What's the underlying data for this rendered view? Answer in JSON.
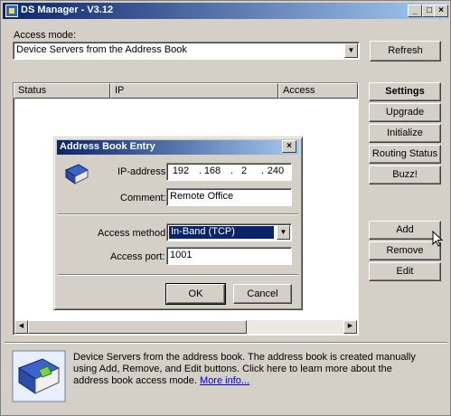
{
  "window": {
    "title": "DS Manager - V3.12"
  },
  "access_mode": {
    "label": "Access mode:",
    "selected": "Device Servers from the Address Book",
    "refresh_label": "Refresh"
  },
  "table": {
    "columns": [
      "Status",
      "IP",
      "Access"
    ]
  },
  "buttons": {
    "settings": "Settings",
    "upgrade": "Upgrade",
    "initialize": "Initialize",
    "routing_status": "Routing Status",
    "buzz": "Buzz!",
    "add": "Add",
    "remove": "Remove",
    "edit": "Edit"
  },
  "dialog": {
    "title": "Address Book Entry",
    "ip_label": "IP-address:",
    "ip_octets": [
      "192",
      "168",
      "2",
      "240"
    ],
    "comment_label": "Comment:",
    "comment_value": "Remote Office",
    "method_label": "Access method:",
    "method_value": "In-Band (TCP)",
    "port_label": "Access port:",
    "port_value": "1001",
    "ok": "OK",
    "cancel": "Cancel"
  },
  "info": {
    "text": "Device Servers from the address book. The address book is created manually using Add, Remove, and Edit buttons. Click here to learn more about the address book access mode.",
    "link": "More info..."
  },
  "icons": [
    "app-icon",
    "address-book-icon",
    "cursor-icon"
  ]
}
